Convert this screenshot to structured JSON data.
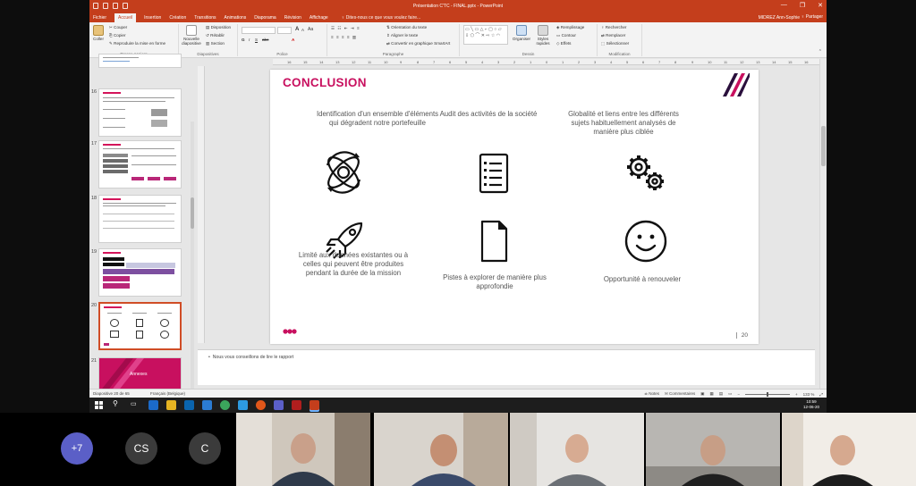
{
  "window": {
    "title": "Présentation C'TC - FINAL.pptx - PowerPoint",
    "minimize": "—",
    "restore": "❐",
    "close": "✕"
  },
  "tabs": [
    "Fichier",
    "Accueil",
    "Insertion",
    "Création",
    "Transitions",
    "Animations",
    "Diaporama",
    "Révision",
    "Affichage"
  ],
  "tellme": "♀ Dites-nous ce que vous voulez faire...",
  "user": "MIDREZ Ann-Sophie",
  "share": "♀ Partager",
  "ribbon": {
    "clipboard": {
      "paste": "Coller",
      "cut": "✂ Couper",
      "copy": "⎘ Copier",
      "format": "✎ Reproduire la mise en forme",
      "label": "Presse-papiers"
    },
    "slides": {
      "new": "Nouvelle diapositive",
      "layout": "▤ Disposition",
      "reset": "↺ Rétablir",
      "section": "▥ Section",
      "label": "Diapositives"
    },
    "font": {
      "label": "Police",
      "bold": "G",
      "italic": "I",
      "underline": "S",
      "strike": "abc",
      "size_up": "A",
      "size_down": "A",
      "aa": "Aa",
      "color": "A"
    },
    "paragraph": {
      "direction": "⇅ Orientation du texte",
      "align": "⇕ Aligner le texte",
      "smartart": "⇄ Convertir en graphique SmartArt",
      "label": "Paragraphe"
    },
    "drawing": {
      "arrange": "Organiser",
      "styles": "Styles rapides",
      "fill": "◈ Remplissage",
      "outline": "▭ Contour",
      "effects": "◇ Effets",
      "label": "Dessin"
    },
    "editing": {
      "find": "♀ Rechercher",
      "replace": "⇄ Remplacer",
      "select": "⬚ Sélectionner",
      "label": "Modification"
    }
  },
  "ruler_ticks": [
    "16",
    "15",
    "14",
    "13",
    "12",
    "11",
    "10",
    "9",
    "8",
    "7",
    "6",
    "5",
    "4",
    "3",
    "2",
    "1",
    "0",
    "1",
    "2",
    "3",
    "4",
    "5",
    "6",
    "7",
    "8",
    "9",
    "10",
    "11",
    "12",
    "13",
    "14",
    "15",
    "16"
  ],
  "thumbnails": [
    {
      "num": "16",
      "selected": false
    },
    {
      "num": "17",
      "selected": false
    },
    {
      "num": "18",
      "selected": false
    },
    {
      "num": "19",
      "selected": false
    },
    {
      "num": "20",
      "selected": true
    },
    {
      "num": "21",
      "selected": false,
      "label": "Annexes"
    }
  ],
  "slide": {
    "title": "CONCLUSION",
    "items": [
      {
        "text": "Identification d'un ensemble d'éléments qui dégradent notre portefeuille",
        "icon": "atom-cycle-icon"
      },
      {
        "text": "Audit des activités de la société",
        "icon": "clipboard-checklist-icon"
      },
      {
        "text": "Globalité et liens entre les différents sujets habituellement analysés de manière plus ciblée",
        "icon": "gears-icon"
      },
      {
        "text": "Limité aux données existantes ou à celles qui peuvent être produites pendant la durée de la mission",
        "icon": "rocket-icon"
      },
      {
        "text": "Pistes à explorer de manière plus approfondie",
        "icon": "document-icon"
      },
      {
        "text": "Opportunité à renouveler",
        "icon": "smiley-icon"
      }
    ],
    "page_number": "20",
    "brand": "VOO"
  },
  "notes": "Nous vous conseillons de lire le rapport",
  "status": {
    "slide": "Diapositive 20 de 65",
    "language": "Français (Belgique)",
    "notes": "≐ Notes",
    "comments": "✉ Commentaires",
    "zoom": "133 %"
  },
  "clock": {
    "time": "10:59",
    "date": "12-06-20"
  },
  "participants": {
    "more": "+7",
    "initials": [
      "CS",
      "C"
    ]
  }
}
